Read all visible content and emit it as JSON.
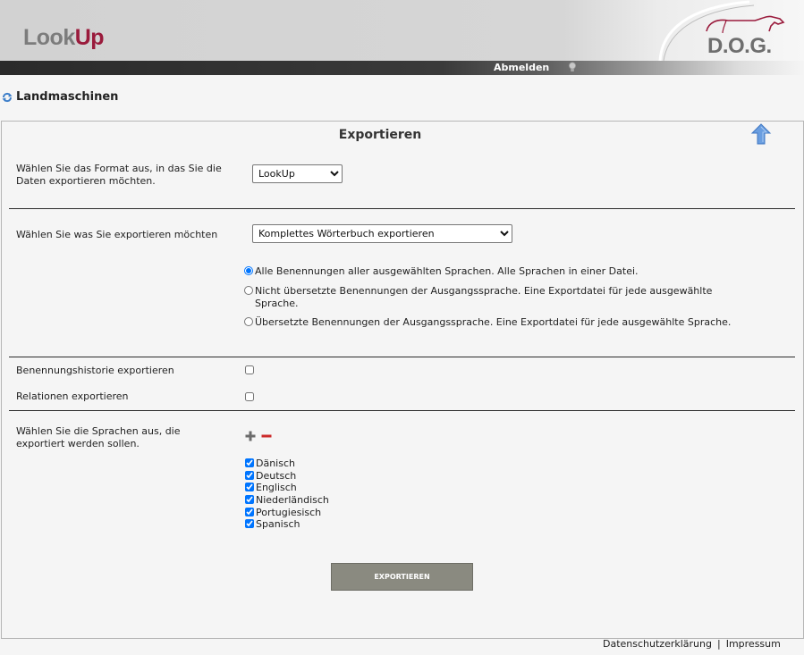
{
  "header": {
    "logo_look": "Look",
    "logo_up": "Up",
    "brand": "D.O.G."
  },
  "nav": {
    "logout_label": "Abmelden",
    "bulb_icon": "lightbulb-icon"
  },
  "page": {
    "title": "Landmaschinen",
    "title_icon": "refresh-icon"
  },
  "export": {
    "heading": "Exportieren",
    "format_label": "Wählen Sie das Format aus, in das Sie die Daten exportieren möchten.",
    "format_selected": "LookUp",
    "what_label": "Wählen Sie was Sie exportieren möchten",
    "what_selected": "Komplettes Wörterbuch exportieren",
    "options": [
      {
        "label": "Alle Benennungen aller ausgewählten Sprachen. Alle Sprachen in einer Datei.",
        "checked": true
      },
      {
        "label": "Nicht übersetzte Benennungen der Ausgangssprache. Eine Exportdatei für jede ausgewählte Sprache.",
        "checked": false
      },
      {
        "label": "Übersetzte Benennungen der Ausgangssprache. Eine Exportdatei für jede ausgewählte Sprache.",
        "checked": false
      }
    ],
    "history_label": "Benennungshistorie exportieren",
    "history_checked": false,
    "relations_label": "Relationen exportieren",
    "relations_checked": false,
    "languages_label": "Wählen Sie die Sprachen aus, die exportiert werden sollen.",
    "languages": [
      {
        "name": "Dänisch",
        "checked": true
      },
      {
        "name": "Deutsch",
        "checked": true
      },
      {
        "name": "Englisch",
        "checked": true
      },
      {
        "name": "Niederländisch",
        "checked": true
      },
      {
        "name": "Portugiesisch",
        "checked": true
      },
      {
        "name": "Spanisch",
        "checked": true
      }
    ],
    "button_label": "EXPORTIEREN"
  },
  "footer": {
    "privacy": "Datenschutzerklärung",
    "separator": "|",
    "imprint": "Impressum"
  },
  "colors": {
    "brand_red": "#9a1b3c",
    "button_gray": "#8a8a80",
    "icon_blue": "#5b8fd6"
  }
}
